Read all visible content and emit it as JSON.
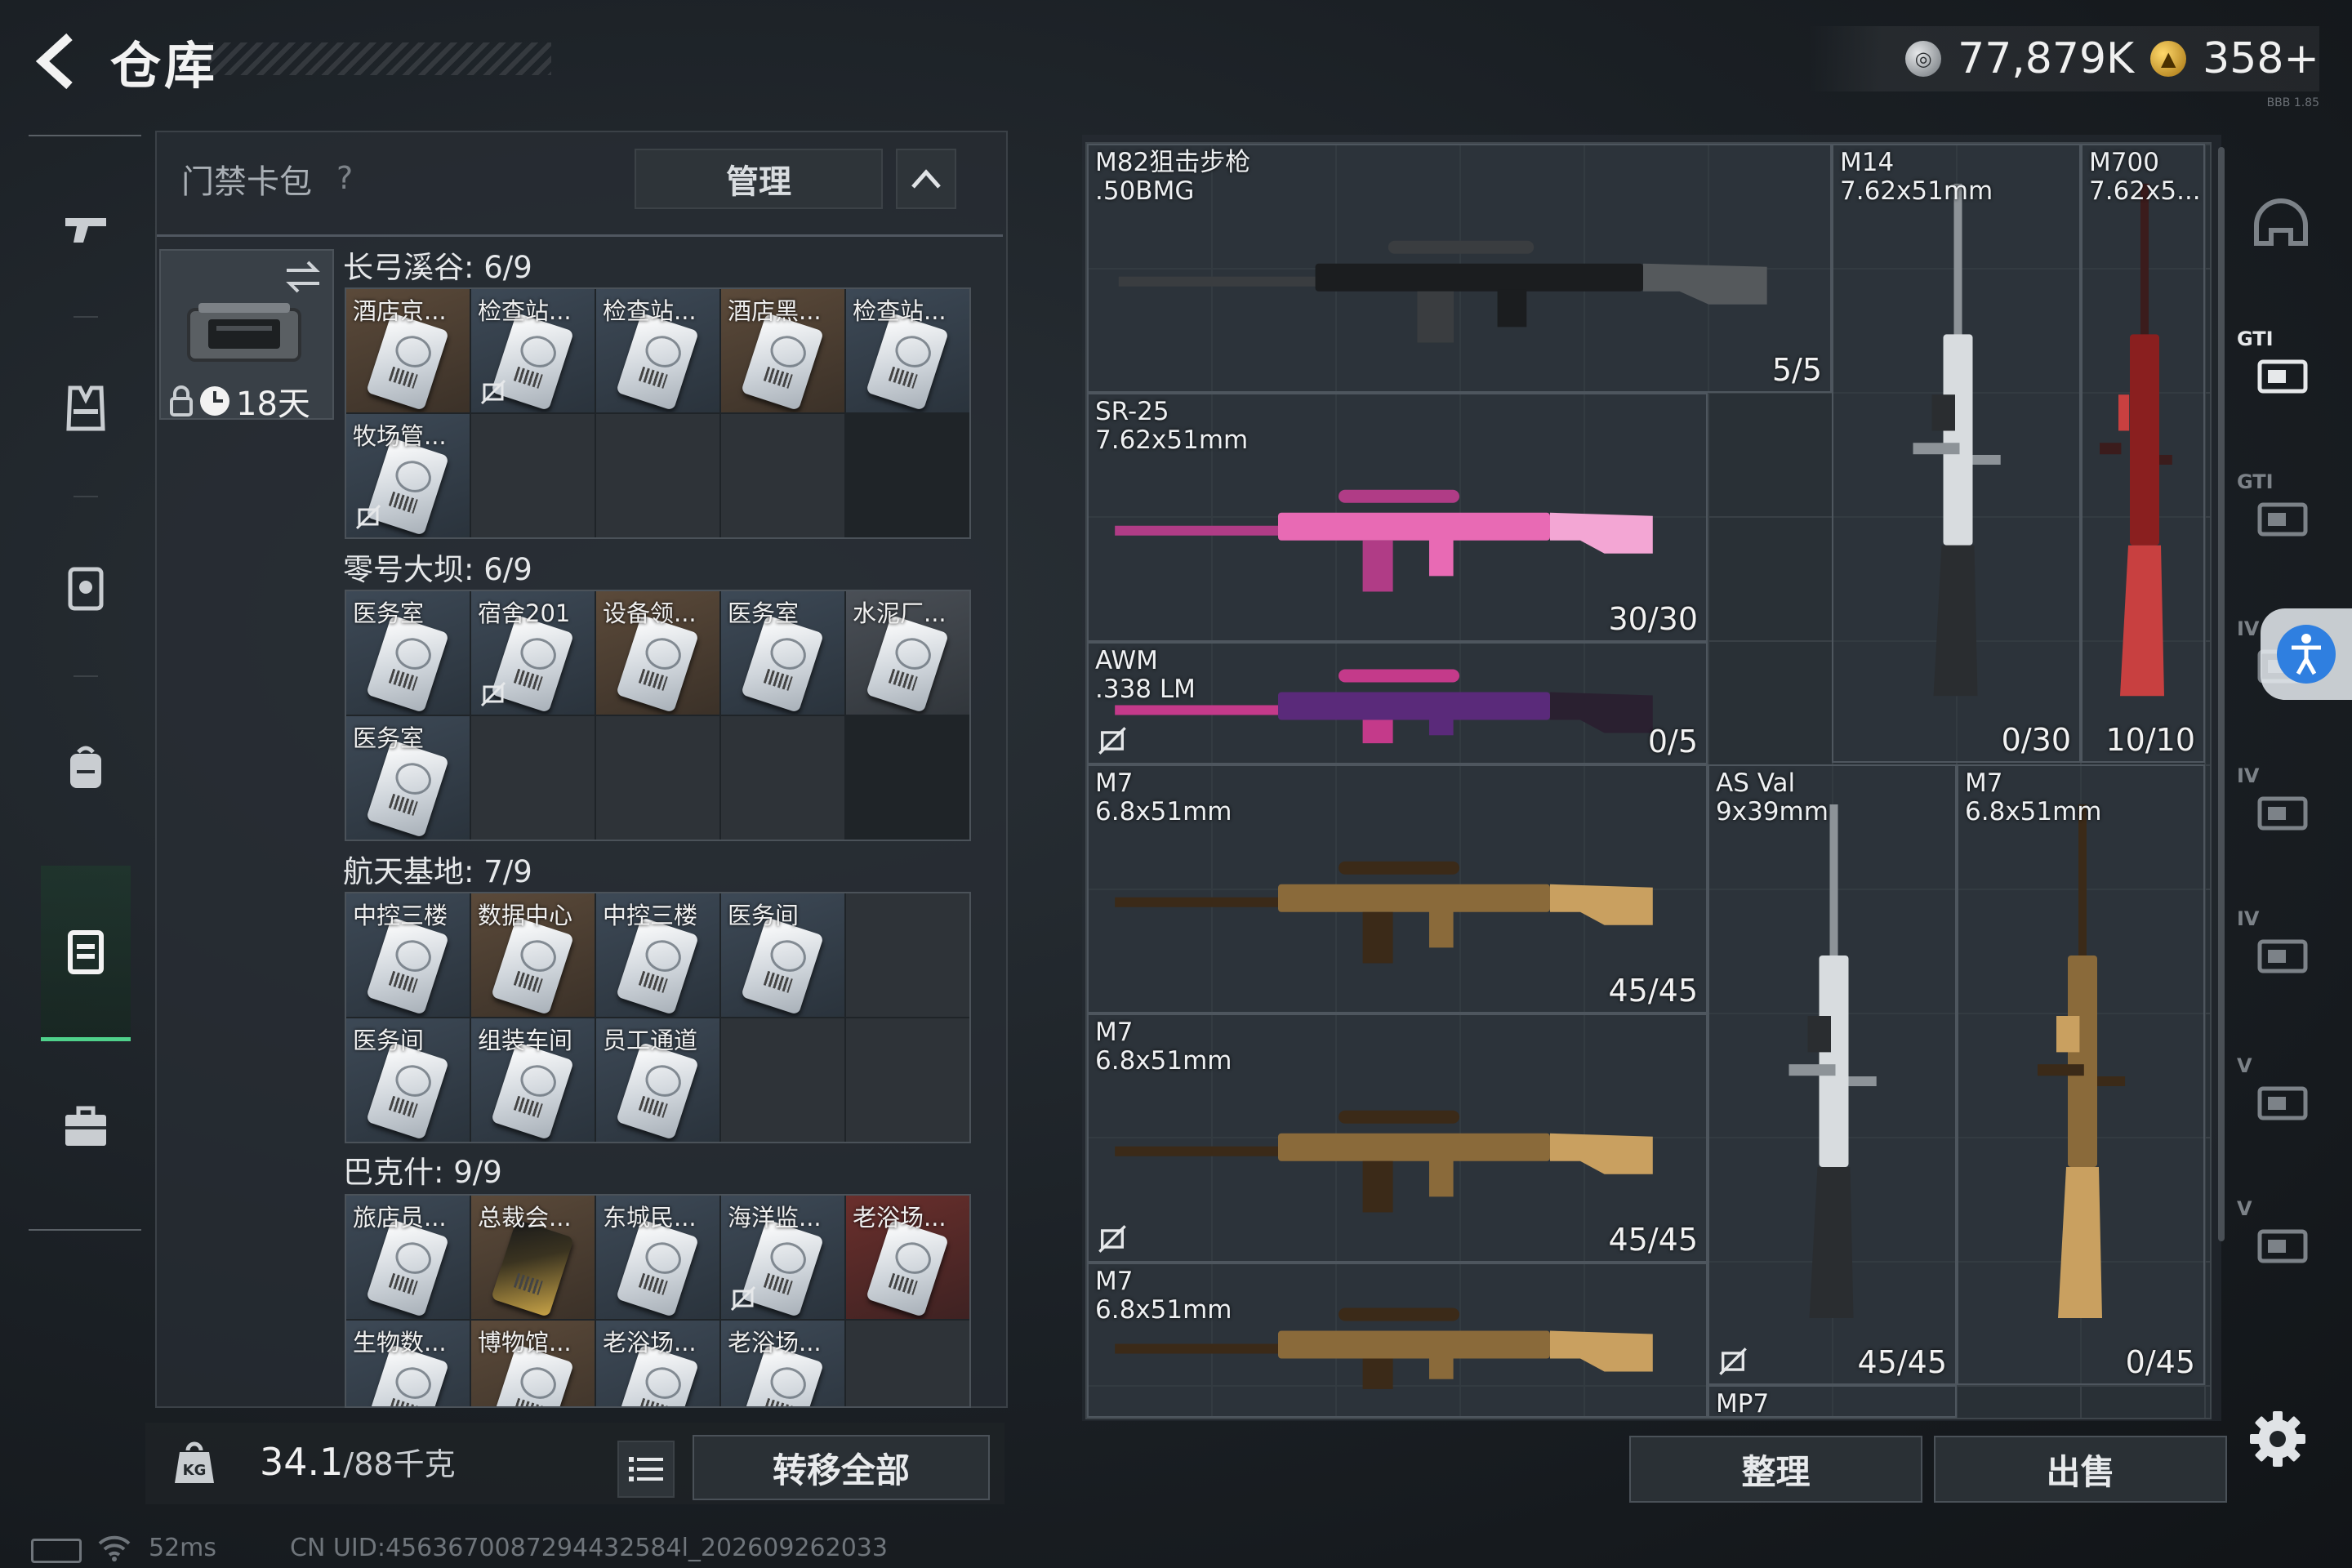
{
  "header": {
    "title": "仓库",
    "currencies": [
      {
        "icon": "silver-coin-icon",
        "amount": "77,879K"
      },
      {
        "icon": "gold-coin-icon",
        "amount": "358+"
      }
    ],
    "version_tag": "BBB 1.85"
  },
  "left_nav": [
    {
      "icon": "pistol-icon",
      "active": false
    },
    {
      "icon": "vest-icon",
      "active": false
    },
    {
      "icon": "armor-icon",
      "active": false
    },
    {
      "icon": "backpack-icon",
      "active": false
    },
    {
      "icon": "keycard-case-icon",
      "active": true
    },
    {
      "icon": "toolbox-icon",
      "active": false
    }
  ],
  "container": {
    "title": "门禁卡包",
    "help": "?",
    "manage_label": "管理",
    "timer": "18天"
  },
  "card_sections": [
    {
      "title": "长弓溪谷: 6/9",
      "slots": [
        {
          "label": "酒店京...",
          "color": "brown",
          "nosell": false
        },
        {
          "label": "检查站...",
          "color": "blue",
          "nosell": true
        },
        {
          "label": "检查站...",
          "color": "blue",
          "nosell": false
        },
        {
          "label": "酒店黑...",
          "color": "brown",
          "nosell": false
        },
        {
          "label": "检查站...",
          "color": "blue",
          "nosell": false
        },
        {
          "label": "牧场管...",
          "color": "blue",
          "nosell": true
        },
        {
          "label": "",
          "color": "empty",
          "nosell": false
        },
        {
          "label": "",
          "color": "empty",
          "nosell": false
        },
        {
          "label": "",
          "color": "empty",
          "nosell": false
        }
      ]
    },
    {
      "title": "零号大坝: 6/9",
      "slots": [
        {
          "label": "医务室",
          "color": "blue",
          "nosell": false
        },
        {
          "label": "宿舍201",
          "color": "blue",
          "nosell": true
        },
        {
          "label": "设备领...",
          "color": "brown",
          "nosell": false
        },
        {
          "label": "医务室",
          "color": "blue",
          "nosell": false
        },
        {
          "label": "水泥厂...",
          "color": "grey",
          "nosell": false
        },
        {
          "label": "医务室",
          "color": "blue",
          "nosell": false
        },
        {
          "label": "",
          "color": "empty",
          "nosell": false
        },
        {
          "label": "",
          "color": "empty",
          "nosell": false
        },
        {
          "label": "",
          "color": "empty",
          "nosell": false
        }
      ]
    },
    {
      "title": "航天基地: 7/9",
      "slots": [
        {
          "label": "中控三楼",
          "color": "blue",
          "nosell": false
        },
        {
          "label": "数据中心",
          "color": "brown",
          "nosell": false
        },
        {
          "label": "中控三楼",
          "color": "blue",
          "nosell": false
        },
        {
          "label": "医务间",
          "color": "blue",
          "nosell": false
        },
        {
          "label": "",
          "color": "empty",
          "nosell": false
        },
        {
          "label": "医务间",
          "color": "blue",
          "nosell": false
        },
        {
          "label": "组装车间",
          "color": "blue",
          "nosell": false
        },
        {
          "label": "员工通道",
          "color": "blue",
          "nosell": false
        },
        {
          "label": "",
          "color": "empty",
          "nosell": false
        },
        {
          "label": "",
          "color": "empty",
          "nosell": false
        }
      ]
    },
    {
      "title": "巴克什: 9/9",
      "slots": [
        {
          "label": "旅店员...",
          "color": "blue",
          "nosell": false
        },
        {
          "label": "总裁会...",
          "color": "brown",
          "nosell": false,
          "gold": true
        },
        {
          "label": "东城民...",
          "color": "blue",
          "nosell": false
        },
        {
          "label": "海洋监...",
          "color": "blue",
          "nosell": true
        },
        {
          "label": "老浴场...",
          "color": "red",
          "nosell": false
        },
        {
          "label": "生物数...",
          "color": "blue",
          "nosell": false
        },
        {
          "label": "博物馆...",
          "color": "brown",
          "nosell": false
        },
        {
          "label": "老浴场...",
          "color": "blue",
          "nosell": false
        },
        {
          "label": "老浴场...",
          "color": "blue",
          "nosell": false
        },
        {
          "label": "",
          "color": "empty",
          "nosell": false
        }
      ]
    }
  ],
  "capacity": {
    "current": "34.1",
    "max": "/88千克",
    "transfer_all_label": "转移全部"
  },
  "stash_weapons": [
    {
      "name": "M82狙击步枪",
      "caliber": ".50BMG",
      "count": "5/5",
      "skin": "black",
      "nosell": false
    },
    {
      "name": "M14",
      "caliber": "7.62x51mm",
      "count": "0/30",
      "skin": "white",
      "nosell": false
    },
    {
      "name": "M700",
      "caliber": "7.62x5...",
      "count": "10/10",
      "skin": "red",
      "nosell": false
    },
    {
      "name": "SR-25",
      "caliber": "7.62x51mm",
      "count": "30/30",
      "skin": "pink",
      "nosell": false
    },
    {
      "name": "AWM",
      "caliber": ".338 LM",
      "count": "0/5",
      "skin": "purple",
      "nosell": true
    },
    {
      "name": "M7",
      "caliber": "6.8x51mm",
      "count": "45/45",
      "skin": "gold",
      "nosell": false
    },
    {
      "name": "AS Val",
      "caliber": "9x39mm",
      "count": "45/45",
      "skin": "white",
      "nosell": true
    },
    {
      "name": "M7",
      "caliber": "6.8x51mm",
      "count": "0/45",
      "skin": "gold",
      "nosell": false
    },
    {
      "name": "M7",
      "caliber": "6.8x51mm",
      "count": "45/45",
      "skin": "gold",
      "nosell": true
    },
    {
      "name": "M7",
      "caliber": "6.8x51mm",
      "count": "",
      "skin": "gold",
      "nosell": false
    },
    {
      "name": "MP7",
      "caliber": "",
      "count": "",
      "skin": "none",
      "nosell": false
    }
  ],
  "actions": {
    "sort_label": "整理",
    "sell_label": "出售"
  },
  "right_rail": [
    {
      "icon": "helmet-icon",
      "text": ""
    },
    {
      "icon": "gti-vehicle-icon",
      "text": "GTI"
    },
    {
      "icon": "gti-box-icon",
      "text": "GTI"
    },
    {
      "icon": "tier-4-icon",
      "text": "IV"
    },
    {
      "icon": "tier-4-folder-icon",
      "text": "IV"
    },
    {
      "icon": "tier-4-folder-icon",
      "text": "IV"
    },
    {
      "icon": "tier-5-icon",
      "text": "V"
    },
    {
      "icon": "tier-5-icon",
      "text": "V"
    }
  ],
  "status": {
    "ping": "52ms",
    "uid": "CN UID:4563670087294432584l_202609262033"
  },
  "colors": {
    "accent_green": "#4fd18b",
    "accessibility_blue": "#2f7fe0"
  }
}
